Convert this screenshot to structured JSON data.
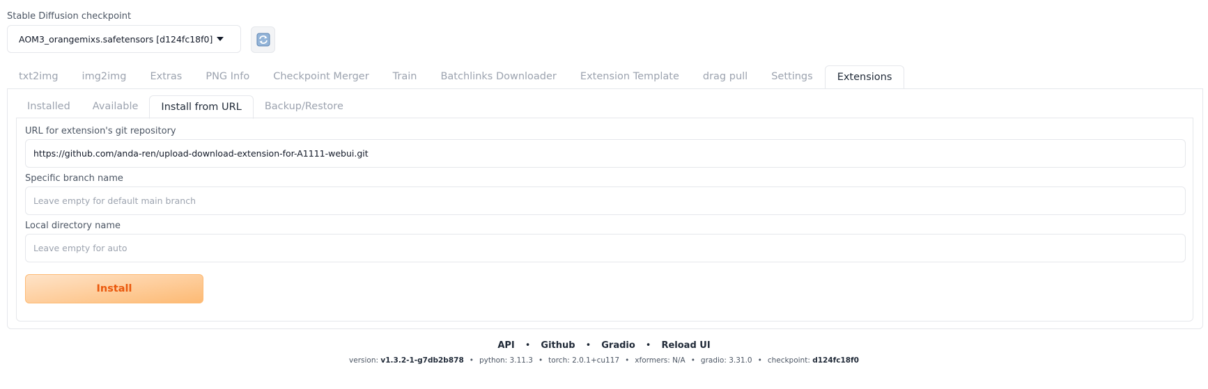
{
  "checkpoint": {
    "label": "Stable Diffusion checkpoint",
    "value": "AOM3_orangemixs.safetensors [d124fc18f0]",
    "refresh_icon": "refresh-icon"
  },
  "top_tabs": [
    {
      "label": "txt2img"
    },
    {
      "label": "img2img"
    },
    {
      "label": "Extras"
    },
    {
      "label": "PNG Info"
    },
    {
      "label": "Checkpoint Merger"
    },
    {
      "label": "Train"
    },
    {
      "label": "Batchlinks Downloader"
    },
    {
      "label": "Extension Template"
    },
    {
      "label": "drag pull"
    },
    {
      "label": "Settings"
    },
    {
      "label": "Extensions"
    }
  ],
  "sub_tabs": [
    {
      "label": "Installed"
    },
    {
      "label": "Available"
    },
    {
      "label": "Install from URL"
    },
    {
      "label": "Backup/Restore"
    }
  ],
  "form": {
    "url_label": "URL for extension's git repository",
    "url_value": "https://github.com/anda-ren/upload-download-extension-for-A1111-webui.git",
    "branch_label": "Specific branch name",
    "branch_placeholder": "Leave empty for default main branch",
    "dir_label": "Local directory name",
    "dir_placeholder": "Leave empty for auto",
    "install_label": "Install"
  },
  "footer": {
    "links": [
      "API",
      "Github",
      "Gradio",
      "Reload UI"
    ],
    "separator": "•",
    "version_label": "version:",
    "version_value": "v1.3.2-1-g7db2b878",
    "python": "python: 3.11.3",
    "torch": "torch: 2.0.1+cu117",
    "xformers": "xformers: N/A",
    "gradio": "gradio: 3.31.0",
    "checkpoint_label": "checkpoint:",
    "checkpoint_value": "d124fc18f0"
  },
  "colors": {
    "accent": "#ea580c",
    "accent_bg": "#fdba74",
    "border": "#e5e7eb",
    "muted_text": "#9ca3af"
  }
}
